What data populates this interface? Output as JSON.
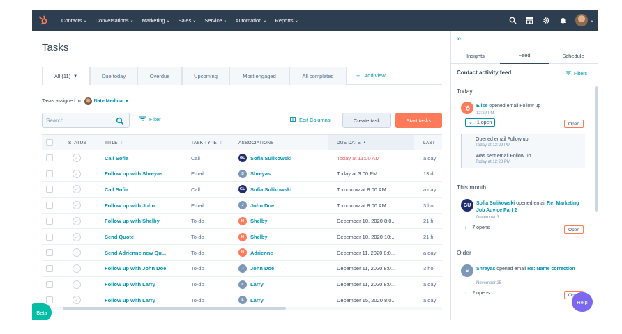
{
  "nav": {
    "items": [
      {
        "label": "Contacts"
      },
      {
        "label": "Conversations"
      },
      {
        "label": "Marketing"
      },
      {
        "label": "Sales"
      },
      {
        "label": "Service"
      },
      {
        "label": "Automation"
      },
      {
        "label": "Reports"
      }
    ]
  },
  "page": {
    "title": "Tasks",
    "views": [
      {
        "label": "All (11)"
      },
      {
        "label": "Due today"
      },
      {
        "label": "Overdue"
      },
      {
        "label": "Upcoming"
      },
      {
        "label": "Most engaged"
      },
      {
        "label": "All completed"
      }
    ],
    "add_view": "Add view",
    "assigned_label": "Tasks assigned to:",
    "assigned_owner": "Nate Medina"
  },
  "toolbar": {
    "search_placeholder": "Search",
    "filter": "Filter",
    "edit_columns": "Edit Columns",
    "create_task": "Create task",
    "start_tasks": "Start tasks"
  },
  "table": {
    "headers": [
      "STATUS",
      "TITLE",
      "TASK TYPE",
      "ASSOCIATIONS",
      "DUE DATE",
      "LAST"
    ],
    "rows": [
      {
        "title": "Call Sofia",
        "type": "Call",
        "assoc": "Sofia Sulikowski",
        "assoc_initials": "GU",
        "assoc_color": "#1f2d6e",
        "due": "Today at 11:00 AM",
        "overdue": true,
        "last": "a day"
      },
      {
        "title": "Follow up with Shreyas",
        "type": "Email",
        "assoc": "Shreyas",
        "assoc_initials": "S",
        "assoc_color": "#7c98b6",
        "due": "Today at 3:00 PM",
        "overdue": false,
        "last": "13 d"
      },
      {
        "title": "Call Sofia",
        "type": "Call",
        "assoc": "Sofia Sulikowski",
        "assoc_initials": "GU",
        "assoc_color": "#1f2d6e",
        "due": "Tomorrow at 8:00 AM",
        "overdue": false,
        "last": "a day"
      },
      {
        "title": "Follow up with John",
        "type": "Email",
        "assoc": "John Doe",
        "assoc_initials": "J",
        "assoc_color": "#7c98b6",
        "due": "Tomorrow at 8:00 AM",
        "overdue": false,
        "last": "3 ho"
      },
      {
        "title": "Follow up with Shelby",
        "type": "To-do",
        "assoc": "Shelby",
        "assoc_initials": "H",
        "assoc_color": "#ff7a59",
        "due": "December 10, 2020 8:0...",
        "overdue": false,
        "last": "21 h"
      },
      {
        "title": "Send Quote",
        "type": "To-do",
        "assoc": "Shelby",
        "assoc_initials": "H",
        "assoc_color": "#ff7a59",
        "due": "December 10, 2020 10:...",
        "overdue": false,
        "last": "21 h"
      },
      {
        "title": "Send Adrienne new Qu...",
        "type": "To-do",
        "assoc": "Adrienne",
        "assoc_initials": "H",
        "assoc_color": "#ff7a59",
        "due": "December 11, 2020 8:0...",
        "overdue": false,
        "last": "a day"
      },
      {
        "title": "Follow up with John Doe",
        "type": "To-do",
        "assoc": "John Doe",
        "assoc_initials": "J",
        "assoc_color": "#7c98b6",
        "due": "December 11, 2020 8:0...",
        "overdue": false,
        "last": "3 ho"
      },
      {
        "title": "Follow up with Larry",
        "type": "To-do",
        "assoc": "Larry",
        "assoc_initials": "L",
        "assoc_color": "#7c98b6",
        "due": "December 11, 2020 8:0...",
        "overdue": false,
        "last": "a day"
      },
      {
        "title": "Follow up with Larry",
        "type": "To-do",
        "assoc": "Larry",
        "assoc_initials": "L",
        "assoc_color": "#7c98b6",
        "due": "December 15, 2020 8:0...",
        "overdue": false,
        "last": "a day"
      }
    ]
  },
  "beta": "Beta",
  "sidebar": {
    "tabs": [
      "Insights",
      "Feed",
      "Schedule"
    ],
    "feed_title": "Contact activity feed",
    "filters": "Filters",
    "today": "Today",
    "this_month": "This month",
    "older": "Older",
    "today_card": {
      "who": "Elise",
      "action": " opened email Follow up",
      "time": "12:29 PM",
      "opens": "1 open",
      "pill": "Open",
      "sub1_text": "Opened email Follow up",
      "sub1_time": "Today at 12:29 PM",
      "sub2_text": "Was sent email Follow up",
      "sub2_time": "Today at 12:28 PM"
    },
    "month_card": {
      "who": "Sofia Sulikowski",
      "action": " opened email ",
      "link": "Re: Marketing Job Advice Part 2",
      "time": "December 3",
      "opens": "7 opens",
      "pill": "Open"
    },
    "older_card": {
      "who": "Shreyas",
      "action": " opened email ",
      "link": "Re: Name correction",
      "time": "November 25",
      "opens": "2 opens",
      "pill": "Open"
    }
  },
  "help": "Help",
  "colors": {
    "nav_bg": "#2d3e50",
    "accent": "#0091ae",
    "cta": "#ff7a59",
    "overdue": "#f2545b",
    "beta": "#00bda5",
    "help": "#7b68ee"
  }
}
